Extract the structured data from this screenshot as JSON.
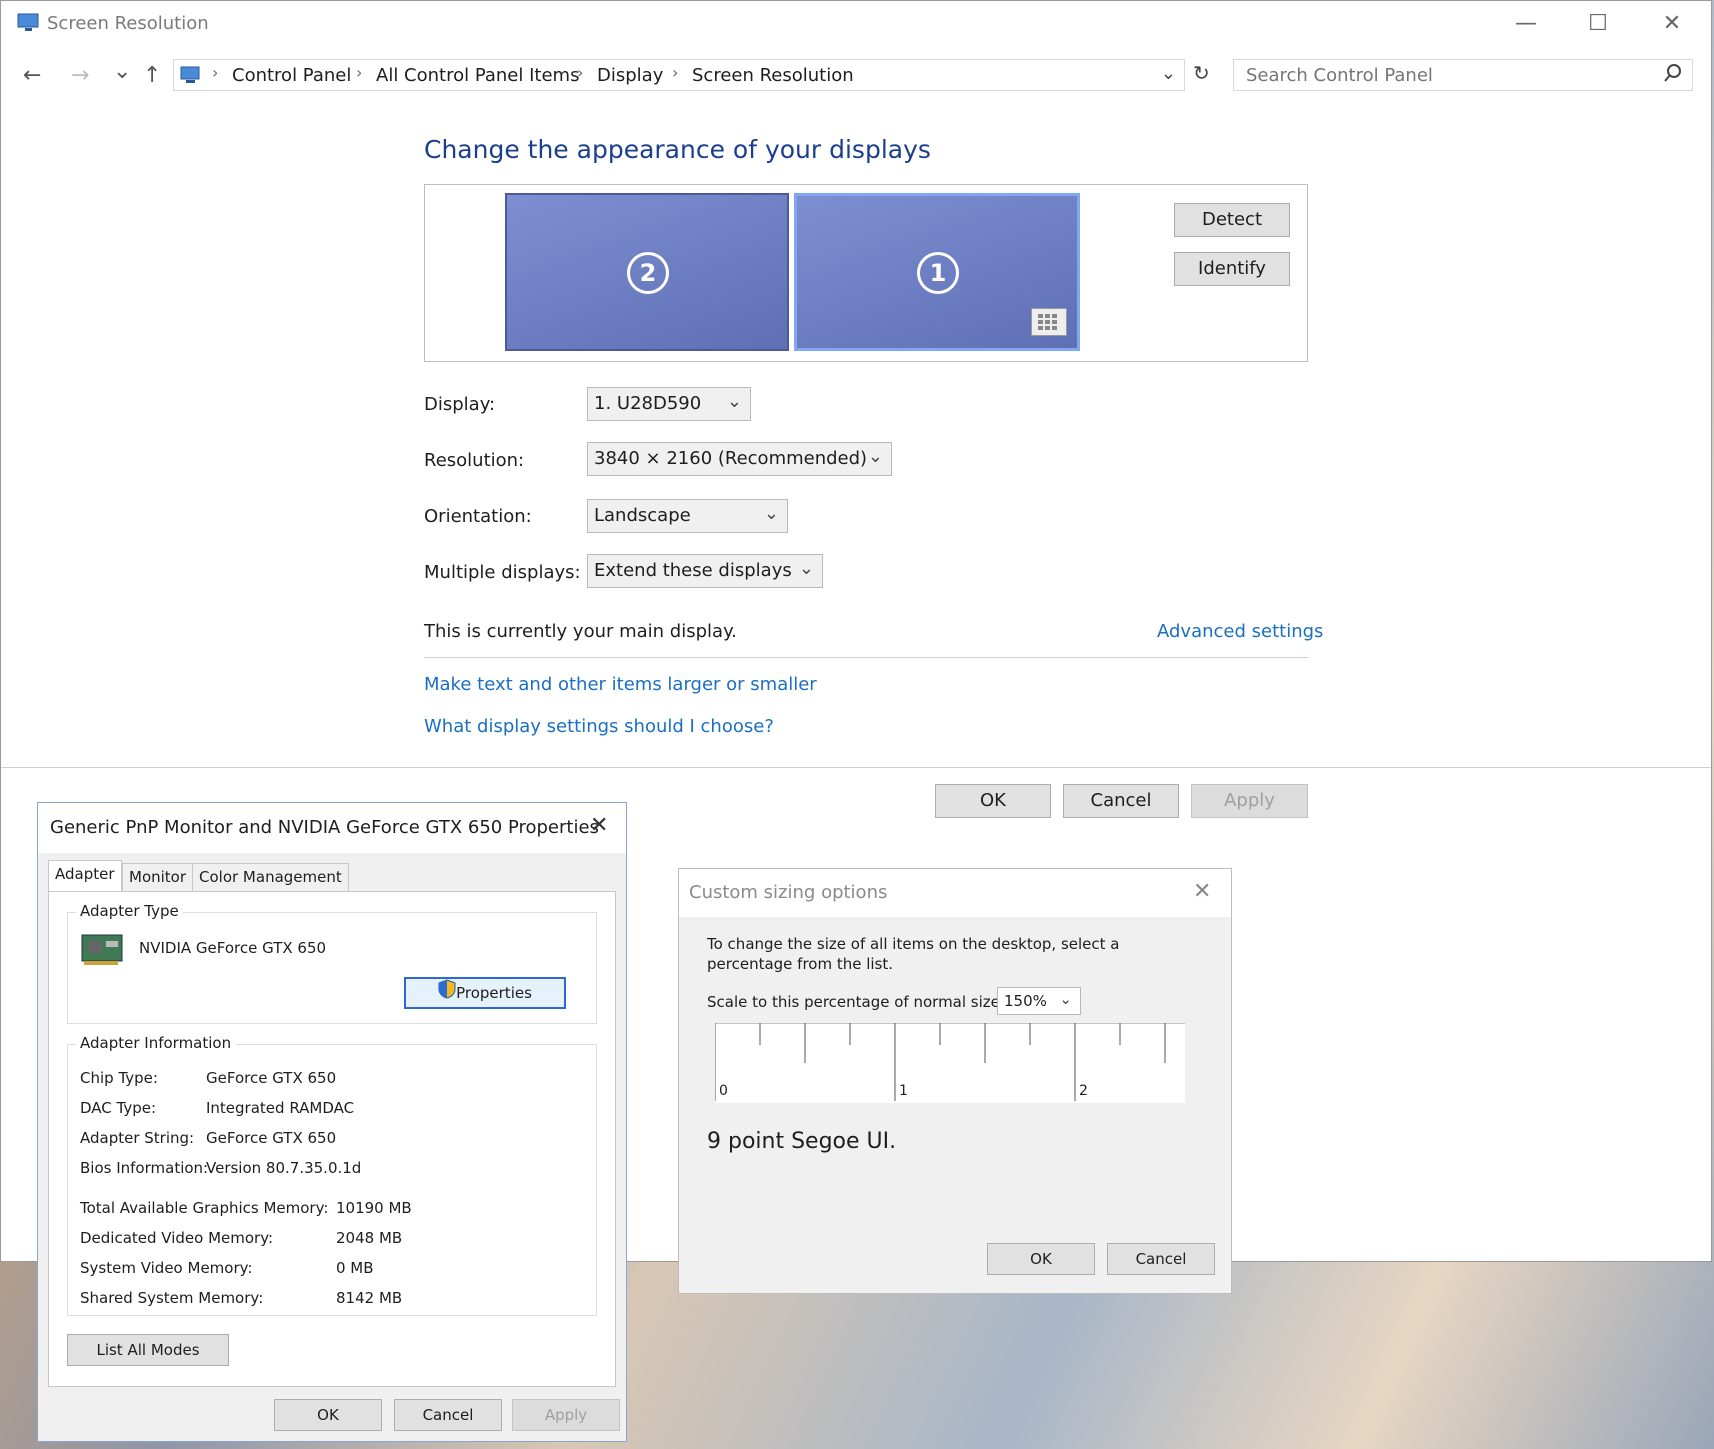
{
  "window": {
    "title": "Screen Resolution",
    "minimize": "—",
    "maximize": "☐",
    "close": "✕"
  },
  "nav": {
    "back": "←",
    "forward": "→",
    "recent": "⌄",
    "up": "↑",
    "breadcrumbs": [
      "Control Panel",
      "All Control Panel Items",
      "Display",
      "Screen Resolution"
    ],
    "search_placeholder": "Search Control Panel"
  },
  "main": {
    "heading": "Change the appearance of your displays",
    "monitors": [
      "2",
      "1"
    ],
    "detect_label": "Detect",
    "identify_label": "Identify",
    "display_label": "Display:",
    "display_value": "1. U28D590",
    "resolution_label": "Resolution:",
    "resolution_value": "3840 × 2160 (Recommended)",
    "orientation_label": "Orientation:",
    "orientation_value": "Landscape",
    "multiple_label": "Multiple displays:",
    "multiple_value": "Extend these displays",
    "main_display_text": "This is currently your main display.",
    "advanced_link": "Advanced settings",
    "link_larger": "Make text and other items larger or smaller",
    "link_choose": "What display settings should I choose?",
    "ok": "OK",
    "cancel": "Cancel",
    "apply": "Apply"
  },
  "props": {
    "title": "Generic PnP Monitor and NVIDIA GeForce GTX 650 Properties",
    "tabs": [
      "Adapter",
      "Monitor",
      "Color Management"
    ],
    "adapter_type_title": "Adapter Type",
    "adapter_name": "NVIDIA GeForce GTX 650",
    "properties_btn": "Properties",
    "adapter_info_title": "Adapter Information",
    "info": [
      {
        "k": "Chip Type:",
        "v": "GeForce GTX 650"
      },
      {
        "k": "DAC Type:",
        "v": "Integrated RAMDAC"
      },
      {
        "k": "Adapter String:",
        "v": "GeForce GTX 650"
      },
      {
        "k": "Bios Information:",
        "v": "Version 80.7.35.0.1d"
      }
    ],
    "memory": [
      {
        "k": "Total Available Graphics Memory:",
        "v": "10190 MB"
      },
      {
        "k": "Dedicated Video Memory:",
        "v": "2048 MB"
      },
      {
        "k": "System Video Memory:",
        "v": "0 MB"
      },
      {
        "k": "Shared System Memory:",
        "v": "8142 MB"
      }
    ],
    "list_all_modes": "List All Modes",
    "ok": "OK",
    "cancel": "Cancel",
    "apply": "Apply"
  },
  "custom": {
    "title": "Custom sizing options",
    "desc1": "To change the size of all items on the desktop, select a",
    "desc2": "percentage from the list.",
    "scale_label": "Scale to this percentage of normal size:",
    "scale_value": "150%",
    "ruler_labels": [
      "0",
      "1",
      "2"
    ],
    "sample_text": "9 point Segoe UI.",
    "ok": "OK",
    "cancel": "Cancel"
  },
  "colors": {
    "heading": "#1b3f8f",
    "link": "#1a6fc2",
    "monitor": "#6b7cc2"
  }
}
